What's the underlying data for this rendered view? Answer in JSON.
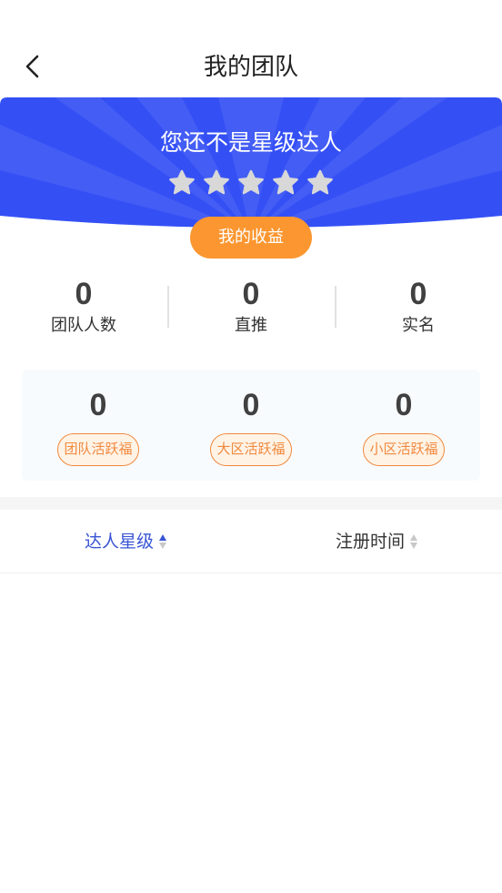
{
  "header": {
    "title": "我的团队"
  },
  "banner": {
    "title": "您还不是星级达人",
    "star_count": 5,
    "income_button": "我的收益"
  },
  "stats": [
    {
      "value": "0",
      "label": "团队人数"
    },
    {
      "value": "0",
      "label": "直推"
    },
    {
      "value": "0",
      "label": "实名"
    }
  ],
  "bonus": [
    {
      "value": "0",
      "label": "团队活跃福"
    },
    {
      "value": "0",
      "label": "大区活跃福"
    },
    {
      "value": "0",
      "label": "小区活跃福"
    }
  ],
  "sort": [
    {
      "label": "达人星级",
      "active": true
    },
    {
      "label": "注册时间",
      "active": false
    }
  ],
  "colors": {
    "primary": "#3450f5",
    "accent": "#fb9630",
    "star": "#d8d8d8"
  }
}
